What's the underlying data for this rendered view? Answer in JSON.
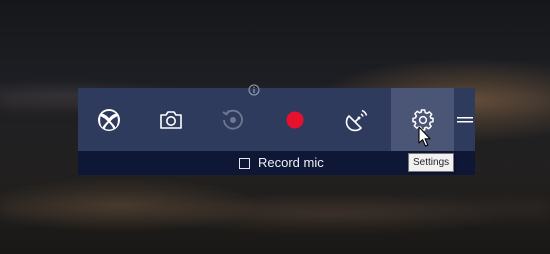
{
  "gamebar": {
    "buttons": [
      {
        "name": "xbox",
        "icon": "xbox-logo-icon"
      },
      {
        "name": "screenshot",
        "icon": "camera-icon"
      },
      {
        "name": "record-that",
        "icon": "record-that-icon",
        "disabled": true
      },
      {
        "name": "start-recording",
        "icon": "record-dot-icon"
      },
      {
        "name": "broadcast",
        "icon": "broadcast-icon"
      },
      {
        "name": "settings",
        "icon": "gear-icon",
        "hovered": true
      }
    ],
    "record_mic_label": "Record mic",
    "record_mic_checked": false
  },
  "tooltip": {
    "text": "Settings"
  },
  "colors": {
    "toolbar_bg": "#2f3b5c",
    "toolbar_hover_bg": "#4b5676",
    "subbar_bg": "#0f1737",
    "record_dot": "#e8112d",
    "icon_white": "#ffffff",
    "icon_disabled": "#6f7891"
  }
}
